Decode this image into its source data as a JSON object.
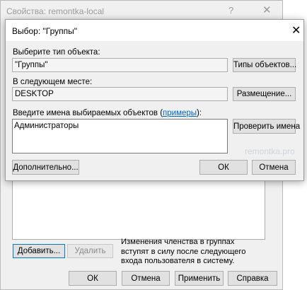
{
  "background_window": {
    "title": "Свойства: remontka-local",
    "help_icon": "?",
    "close_icon": "✕",
    "add_button": "Добавить...",
    "remove_button": "Удалить",
    "note": "Изменения членства в группах вступят в силу после следующего входа пользователя в систему.",
    "ok_button": "ОК",
    "cancel_button": "Отмена",
    "apply_button": "Применить",
    "help_button": "Справка"
  },
  "dialog": {
    "title": "Выбор: \"Группы\"",
    "close_icon": "✕",
    "object_type_label": "Выберите тип объекта:",
    "object_type_value": "\"Группы\"",
    "object_types_button": "Типы объектов...",
    "location_label": "В следующем месте:",
    "location_value": "DESKTOP",
    "location_button": "Размещение...",
    "names_label_prefix": "Введите имена выбираемых объектов (",
    "names_label_link": "примеры",
    "names_label_suffix": "):",
    "names_value": "Администраторы",
    "check_names_button": "Проверить имена",
    "advanced_button": "Дополнительно...",
    "ok_button": "ОК",
    "cancel_button": "Отмена"
  },
  "watermark": "remontka.pro"
}
